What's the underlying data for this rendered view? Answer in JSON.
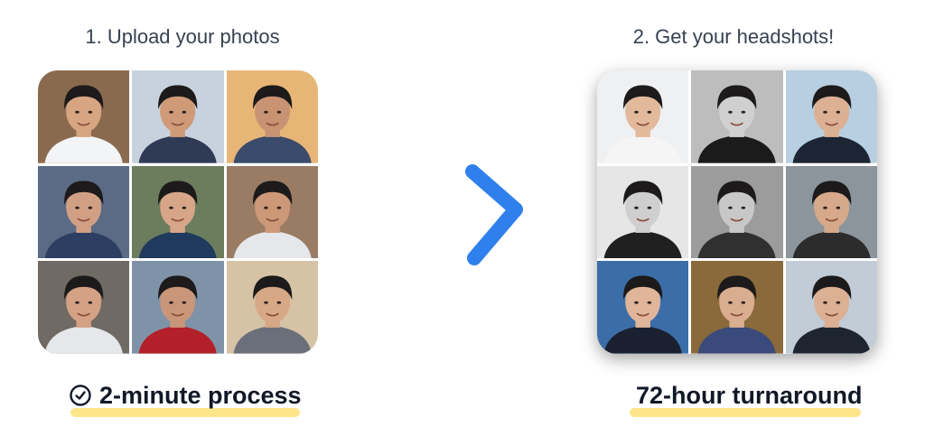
{
  "left": {
    "title": "1. Upload your photos",
    "caption": "2-minute process",
    "photos": [
      {
        "bg": "#8a6a4e",
        "shirt": "#f3f4f6",
        "skin": "#d8a583"
      },
      {
        "bg": "#c7d2de",
        "shirt": "#2f3b55",
        "skin": "#cf9a78"
      },
      {
        "bg": "#e7b676",
        "shirt": "#3a4b6b",
        "skin": "#c99373"
      },
      {
        "bg": "#5b6b85",
        "shirt": "#2d3e63",
        "skin": "#d1a084"
      },
      {
        "bg": "#6b7d5c",
        "shirt": "#1f3a5c",
        "skin": "#d7a688"
      },
      {
        "bg": "#9a7c64",
        "shirt": "#e5e7eb",
        "skin": "#cc9877"
      },
      {
        "bg": "#6f6a63",
        "shirt": "#e5e7eb",
        "skin": "#d4a185"
      },
      {
        "bg": "#7f93a8",
        "shirt": "#b3202a",
        "skin": "#c9967a"
      },
      {
        "bg": "#d6c3a6",
        "shirt": "#6a6f7a",
        "skin": "#d6a886"
      }
    ]
  },
  "right": {
    "title": "2. Get your headshots!",
    "caption": "72-hour turnaround",
    "photos": [
      {
        "bg": "#eef0f2",
        "shirt": "#f5f5f5",
        "skin": "#e2b99b"
      },
      {
        "bg": "#bdbdbd",
        "shirt": "#1b1b1b",
        "skin": "#d0d0d0"
      },
      {
        "bg": "#b7cfe0",
        "shirt": "#1d2433",
        "skin": "#dcb093"
      },
      {
        "bg": "#e6e6e6",
        "shirt": "#202020",
        "skin": "#cfcfcf"
      },
      {
        "bg": "#9c9c9c",
        "shirt": "#303030",
        "skin": "#c8c8c8"
      },
      {
        "bg": "#8c949c",
        "shirt": "#2c2c2c",
        "skin": "#d6a98a"
      },
      {
        "bg": "#3b6ea8",
        "shirt": "#1a2030",
        "skin": "#e0b59a"
      },
      {
        "bg": "#8a6a3a",
        "shirt": "#3a4a7a",
        "skin": "#d9ad8f"
      },
      {
        "bg": "#c2ccd6",
        "shirt": "#1f2530",
        "skin": "#dcb093"
      }
    ]
  },
  "icons": {
    "clock": "clock-check-icon",
    "arrow": "right-arrow-icon"
  },
  "colors": {
    "arrow": "#2f80ed",
    "underline": "#fde68a",
    "hair": "#1c1a1a"
  }
}
